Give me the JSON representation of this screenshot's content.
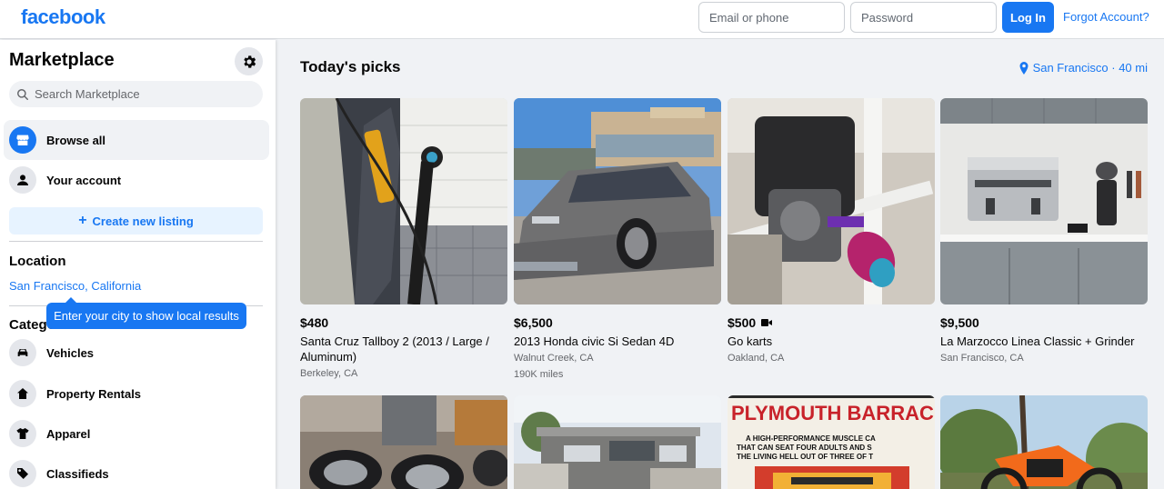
{
  "header": {
    "logo_text": "facebook",
    "email_placeholder": "Email or phone",
    "password_placeholder": "Password",
    "login_label": "Log In",
    "forgot_label": "Forgot Account?"
  },
  "sidebar": {
    "title": "Marketplace",
    "settings_icon": "gear-icon",
    "search_placeholder": "Search Marketplace",
    "nav": [
      {
        "label": "Browse all",
        "icon": "storefront-icon",
        "active": true
      },
      {
        "label": "Your account",
        "icon": "person-icon",
        "active": false
      }
    ],
    "create_label": "Create new listing",
    "location_title": "Location",
    "location_value": "San Francisco, California",
    "tooltip": "Enter your city to show local results",
    "categories_title": "Categories",
    "categories": [
      {
        "label": "Vehicles",
        "icon": "car-icon"
      },
      {
        "label": "Property Rentals",
        "icon": "house-icon"
      },
      {
        "label": "Apparel",
        "icon": "shirt-icon"
      },
      {
        "label": "Classifieds",
        "icon": "tag-icon"
      }
    ]
  },
  "main": {
    "title": "Today's picks",
    "location_badge": "San Francisco · 40 mi",
    "listings": [
      {
        "price": "$480",
        "title": "Santa Cruz Tallboy 2 (2013 / Large / Aluminum)",
        "location": "Berkeley, CA",
        "extra": ""
      },
      {
        "price": "$6,500",
        "title": "2013 Honda civic Si Sedan 4D",
        "location": "Walnut Creek, CA",
        "extra": "190K miles"
      },
      {
        "price": "$500",
        "title": "Go karts",
        "location": "Oakland, CA",
        "extra": "",
        "video": true
      },
      {
        "price": "$9,500",
        "title": "La Marzocco Linea Classic + Grinder",
        "location": "San Francisco, CA",
        "extra": ""
      }
    ],
    "row2_sign_lines": [
      "PLYMOUTH BARRACU",
      "A HIGH-PERFORMANCE MUSCLE CA",
      "THAT CAN SEAT FOUR ADULTS AND S",
      "THE LIVING HELL OUT OF THREE OF T"
    ]
  },
  "colors": {
    "brand": "#1877f2",
    "background": "#f0f2f5"
  }
}
